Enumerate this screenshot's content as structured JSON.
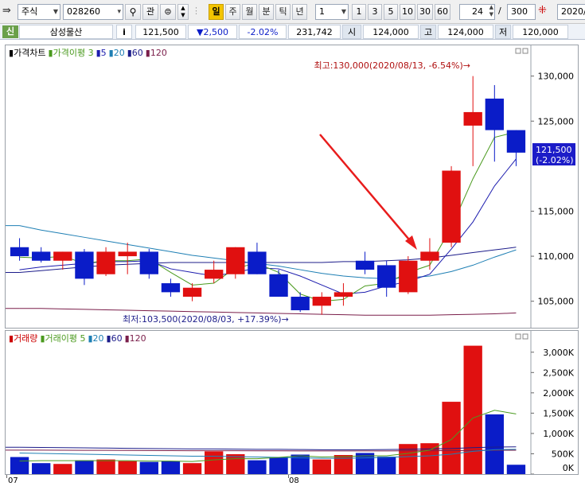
{
  "toolbar": {
    "market_type": "주식",
    "code": "028260",
    "search_icon": "magnifier-icon",
    "interest_label": "관",
    "periods": [
      {
        "label": "일",
        "active": true
      },
      {
        "label": "주",
        "active": false
      },
      {
        "label": "월",
        "active": false
      },
      {
        "label": "분",
        "active": false
      },
      {
        "label": "틱",
        "active": false
      },
      {
        "label": "년",
        "active": false
      }
    ],
    "interval_value": "1",
    "interval_buttons": [
      "1",
      "3",
      "5",
      "10",
      "30",
      "60"
    ],
    "count_value": "24",
    "total_sep": "/",
    "total_value": "300",
    "date_value": "2020/"
  },
  "info": {
    "credit_badge": "신",
    "name": "삼성물산",
    "info_button": "i",
    "price": "121,500",
    "change": "▼2,500",
    "change_rate": "-2.02%",
    "volume": "231,742",
    "open_label": "시",
    "open": "124,000",
    "high_label": "고",
    "high": "124,000",
    "low_label": "저",
    "low": "120,000"
  },
  "price_panel": {
    "legend": [
      {
        "text": "가격차트",
        "color": "#000000"
      },
      {
        "text": "가격이평 3",
        "color": "#4a9a1e"
      },
      {
        "text": "5",
        "color": "#1c1cae"
      },
      {
        "text": "20",
        "color": "#1e7fb4"
      },
      {
        "text": "60",
        "color": "#1c1c8a"
      },
      {
        "text": "120",
        "color": "#7a1e4a"
      }
    ],
    "high_annotation": "최고:130,000(2020/08/13, -6.54%)→",
    "low_annotation": "최저:103,500(2020/08/03, +17.39%)→",
    "current_price_label": "121,500",
    "current_change_label": "(-2.02%)",
    "axis_labels": [
      "130,000",
      "125,000",
      "115,000",
      "110,000",
      "105,000"
    ]
  },
  "volume_panel": {
    "legend": [
      {
        "text": "거래량",
        "color": "#cc0000"
      },
      {
        "text": "거래이평 5",
        "color": "#4a9a1e"
      },
      {
        "text": "20",
        "color": "#1e7fb4"
      },
      {
        "text": "60",
        "color": "#1c1c8a"
      },
      {
        "text": "120",
        "color": "#7a1e4a"
      }
    ],
    "axis_labels": [
      "3,000K",
      "2,500K",
      "2,000K",
      "1,500K",
      "1,000K",
      "500K",
      "0K"
    ]
  },
  "x_axis": {
    "labels": [
      "07",
      "08"
    ]
  },
  "chart_data": {
    "type": "candlestick",
    "candles": [
      {
        "o": 111000,
        "h": 112000,
        "l": 109500,
        "c": 110000
      },
      {
        "o": 110500,
        "h": 111000,
        "l": 109300,
        "c": 109500
      },
      {
        "o": 109500,
        "h": 110500,
        "l": 108500,
        "c": 110500
      },
      {
        "o": 110500,
        "h": 110800,
        "l": 106800,
        "c": 107500
      },
      {
        "o": 108000,
        "h": 111000,
        "l": 107800,
        "c": 110500
      },
      {
        "o": 110000,
        "h": 111500,
        "l": 108000,
        "c": 110500
      },
      {
        "o": 110500,
        "h": 110800,
        "l": 107500,
        "c": 108000
      },
      {
        "o": 107000,
        "h": 107500,
        "l": 105500,
        "c": 106000
      },
      {
        "o": 105500,
        "h": 107000,
        "l": 105000,
        "c": 106500
      },
      {
        "o": 107500,
        "h": 109500,
        "l": 107000,
        "c": 108500
      },
      {
        "o": 108000,
        "h": 111000,
        "l": 107500,
        "c": 111000
      },
      {
        "o": 110500,
        "h": 111500,
        "l": 108000,
        "c": 108000
      },
      {
        "o": 108000,
        "h": 108500,
        "l": 105500,
        "c": 105500
      },
      {
        "o": 105500,
        "h": 106000,
        "l": 103800,
        "c": 104000
      },
      {
        "o": 104500,
        "h": 106000,
        "l": 103500,
        "c": 105500
      },
      {
        "o": 105500,
        "h": 107000,
        "l": 104500,
        "c": 106000
      },
      {
        "o": 109500,
        "h": 110500,
        "l": 108000,
        "c": 108500
      },
      {
        "o": 109000,
        "h": 109500,
        "l": 105500,
        "c": 106500
      },
      {
        "o": 106000,
        "h": 110000,
        "l": 105800,
        "c": 109500
      },
      {
        "o": 109500,
        "h": 112000,
        "l": 108500,
        "c": 110500
      },
      {
        "o": 111500,
        "h": 120000,
        "l": 111000,
        "c": 119500
      },
      {
        "o": 124500,
        "h": 130000,
        "l": 120000,
        "c": 126000
      },
      {
        "o": 127500,
        "h": 129000,
        "l": 120500,
        "c": 124000
      },
      {
        "o": 124000,
        "h": 124000,
        "l": 120000,
        "c": 121500
      }
    ],
    "volumes": [
      420000,
      270000,
      250000,
      340000,
      360000,
      320000,
      300000,
      320000,
      270000,
      560000,
      490000,
      340000,
      420000,
      480000,
      360000,
      470000,
      520000,
      430000,
      740000,
      760000,
      1780000,
      3160000,
      1470000,
      230000
    ],
    "y_price_range": [
      102500,
      132000
    ],
    "y_volume_range": [
      0,
      3250000
    ],
    "x_labels": [
      "07",
      "08"
    ],
    "overlays": {
      "ma3": [
        109900,
        109800,
        110000,
        109200,
        109500,
        109500,
        109700,
        108200,
        106800,
        107000,
        108700,
        109200,
        108200,
        105800,
        105000,
        105200,
        106700,
        107000,
        108200,
        109000,
        113200,
        118600,
        123200,
        123800
      ],
      "ma5": [
        108500,
        108800,
        109000,
        109200,
        109400,
        109400,
        109500,
        108600,
        108200,
        107800,
        108200,
        108700,
        108600,
        107800,
        106800,
        105800,
        106000,
        106700,
        107200,
        108000,
        110800,
        113800,
        117800,
        120800
      ],
      "ma20": [
        113400,
        112900,
        112500,
        112100,
        111700,
        111300,
        110900,
        110500,
        110100,
        109800,
        109500,
        109200,
        108900,
        108500,
        108100,
        107800,
        107600,
        107500,
        107600,
        107800,
        108300,
        109000,
        109900,
        110700
      ],
      "ma60": [
        108200,
        108400,
        108600,
        108800,
        109000,
        109100,
        109200,
        109300,
        109300,
        109300,
        109300,
        109300,
        109300,
        109300,
        109300,
        109400,
        109400,
        109500,
        109600,
        109800,
        110100,
        110400,
        110700,
        111000
      ],
      "ma120": [
        104200,
        104200,
        104150,
        104100,
        104050,
        104000,
        103950,
        103900,
        103850,
        103800,
        103750,
        103700,
        103650,
        103600,
        103550,
        103500,
        103450,
        103450,
        103450,
        103450,
        103500,
        103550,
        103600,
        103700
      ],
      "vma5": [
        320000,
        330000,
        330000,
        330000,
        330000,
        330000,
        320000,
        320000,
        310000,
        350000,
        380000,
        380000,
        410000,
        450000,
        420000,
        430000,
        450000,
        450000,
        510000,
        590000,
        850000,
        1380000,
        1570000,
        1480000
      ],
      "vma20": [
        520000,
        510000,
        500000,
        490000,
        480000,
        470000,
        460000,
        450000,
        440000,
        440000,
        430000,
        420000,
        410000,
        400000,
        390000,
        390000,
        400000,
        410000,
        430000,
        450000,
        490000,
        560000,
        600000,
        610000
      ],
      "vma60": [
        660000,
        655000,
        650000,
        645000,
        640000,
        635000,
        630000,
        625000,
        620000,
        620000,
        615000,
        610000,
        610000,
        605000,
        600000,
        600000,
        600000,
        605000,
        610000,
        620000,
        630000,
        650000,
        665000,
        670000
      ],
      "vma120": [
        590000,
        590000,
        588000,
        586000,
        584000,
        582000,
        580000,
        578000,
        576000,
        575000,
        574000,
        573000,
        572000,
        571000,
        570000,
        570000,
        570000,
        571000,
        572000,
        574000,
        577000,
        582000,
        586000,
        588000
      ]
    },
    "colors": {
      "up": "#e01010",
      "down": "#0a1cc8",
      "ma3": "#4a9a1e",
      "ma5": "#1c1cae",
      "ma20": "#1e7fb4",
      "ma60": "#1c1c8a",
      "ma120": "#7a1e4a",
      "arrow": "#e81c1c",
      "annotation": "#b01010"
    }
  }
}
